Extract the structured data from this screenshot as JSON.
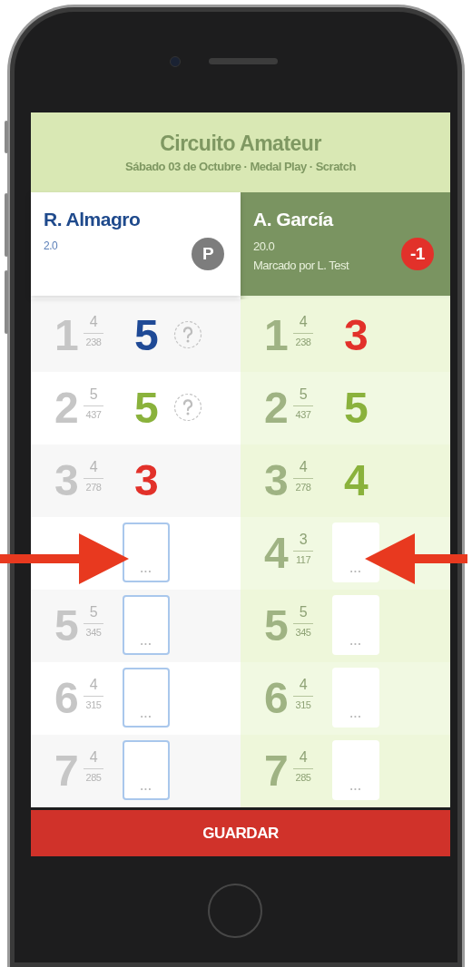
{
  "header": {
    "title": "Circuito Amateur",
    "subtitle": "Sábado 03 de Octubre · Medal Play · Scratch"
  },
  "players": [
    {
      "name": "R. Almagro",
      "handicap": "2.0",
      "selected": false,
      "badge": {
        "kind": "status",
        "text": "P"
      },
      "holes": [
        {
          "hole": "1",
          "par": "4",
          "distance": "238",
          "score": "5",
          "color": "#1f4a96",
          "unconfirmed": true
        },
        {
          "hole": "2",
          "par": "5",
          "distance": "437",
          "score": "5",
          "color": "#8ab23c",
          "unconfirmed": true
        },
        {
          "hole": "3",
          "par": "4",
          "distance": "278",
          "score": "3",
          "color": "#e2312a",
          "unconfirmed": false
        },
        {
          "placeholder": "...",
          "unconfirmed": false
        },
        {
          "hole": "5",
          "par": "5",
          "distance": "345",
          "placeholder": "...",
          "unconfirmed": false
        },
        {
          "hole": "6",
          "par": "4",
          "distance": "315",
          "placeholder": "...",
          "unconfirmed": false
        },
        {
          "hole": "7",
          "par": "4",
          "distance": "285",
          "placeholder": "...",
          "unconfirmed": false
        }
      ]
    },
    {
      "name": "A. García",
      "handicap": "20.0",
      "marker": "Marcado por L. Test",
      "selected": true,
      "badge": {
        "kind": "score",
        "text": "-1"
      },
      "holes": [
        {
          "hole": "1",
          "par": "4",
          "distance": "238",
          "score": "3",
          "color": "#e2312a",
          "unconfirmed": false
        },
        {
          "hole": "2",
          "par": "5",
          "distance": "437",
          "score": "5",
          "color": "#8ab23c",
          "unconfirmed": false
        },
        {
          "hole": "3",
          "par": "4",
          "distance": "278",
          "score": "4",
          "color": "#8ab23c",
          "unconfirmed": false
        },
        {
          "hole": "4",
          "par": "3",
          "distance": "117",
          "placeholder": "...",
          "unconfirmed": false
        },
        {
          "hole": "5",
          "par": "5",
          "distance": "345",
          "placeholder": "...",
          "unconfirmed": false
        },
        {
          "hole": "6",
          "par": "4",
          "distance": "315",
          "placeholder": "...",
          "unconfirmed": false
        },
        {
          "hole": "7",
          "par": "4",
          "distance": "285",
          "placeholder": "...",
          "unconfirmed": false
        }
      ]
    }
  ],
  "save_button": "GUARDAR"
}
